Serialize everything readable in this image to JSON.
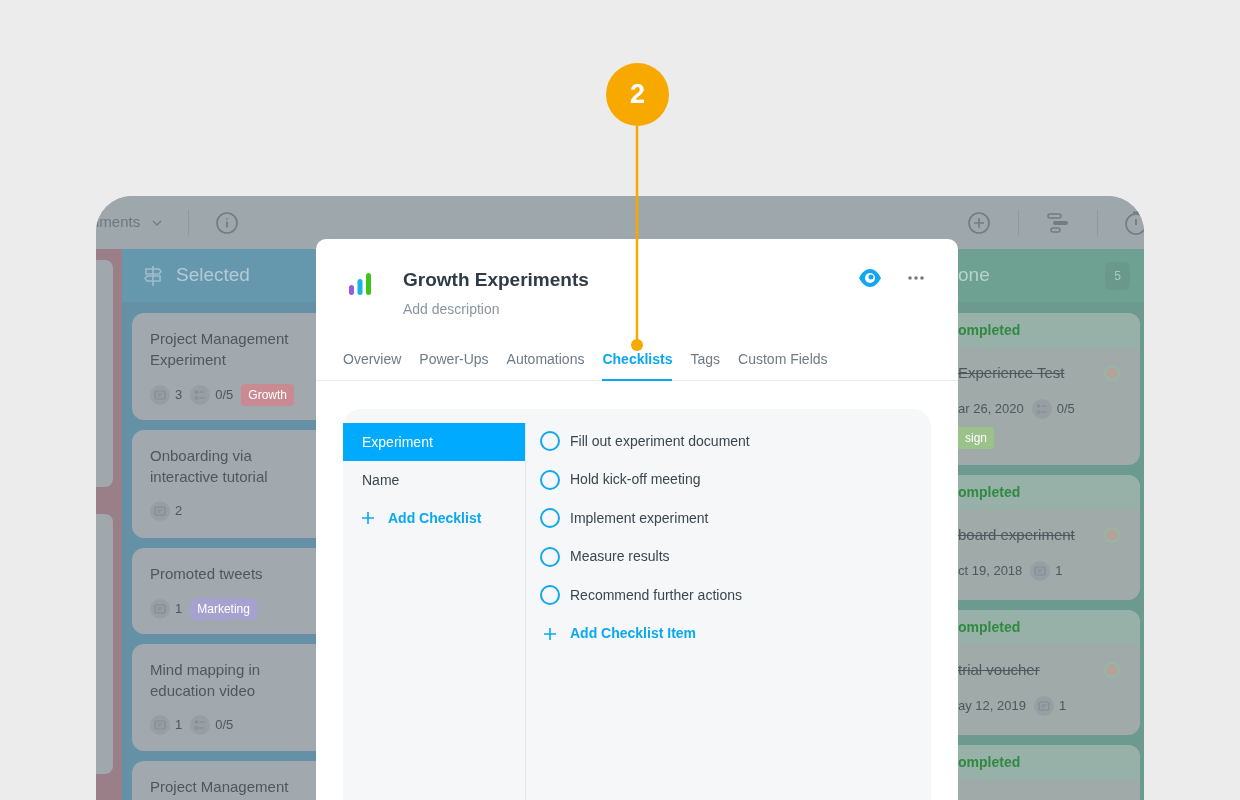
{
  "callout": {
    "number": "2"
  },
  "toolbar": {
    "view_name": "iments"
  },
  "selected_column": {
    "title": "Selected",
    "cards": [
      {
        "title": "Project Management Experiment",
        "comments": "3",
        "checklist": "0/5",
        "tag": {
          "label": "Growth",
          "color": "#c98a92"
        }
      },
      {
        "title": "Onboarding via interactive tutorial",
        "comments": "2"
      },
      {
        "title": "Promoted tweets",
        "comments": "1",
        "tag": {
          "label": "Marketing",
          "color": "#a7a1d0"
        }
      },
      {
        "title": "Mind mapping in education video",
        "comments": "1",
        "checklist": "0/5"
      },
      {
        "title": "Project Management"
      }
    ]
  },
  "done_column": {
    "title": "one",
    "count": "5",
    "cards": [
      {
        "status": "ompleted",
        "title": "Experience Test",
        "completed": true,
        "date": "ar 26, 2020",
        "checklist": "0/5",
        "tag": {
          "label": "sign",
          "color": "#9cc28c"
        }
      },
      {
        "status": "ompleted",
        "title": "board experiment",
        "completed": true,
        "date": "ct 19, 2018",
        "comments": "1"
      },
      {
        "status": "ompleted",
        "title": "trial voucher",
        "completed": true,
        "date": "ay 12, 2019",
        "comments": "1"
      },
      {
        "status": "ompleted"
      }
    ]
  },
  "modal": {
    "title": "Growth Experiments",
    "description": {
      "placeholder": "Add description"
    },
    "watching": true,
    "tabs": [
      {
        "label": "Overview",
        "selected": false
      },
      {
        "label": "Power-Ups",
        "selected": false
      },
      {
        "label": "Automations",
        "selected": false
      },
      {
        "label": "Checklists",
        "selected": true
      },
      {
        "label": "Tags",
        "selected": false
      },
      {
        "label": "Custom Fields",
        "selected": false
      }
    ],
    "checklists": [
      {
        "label": "Experiment",
        "selected": true
      },
      {
        "label": "Name",
        "selected": false
      }
    ],
    "add_checklist": "Add Checklist",
    "items": [
      {
        "label": "Fill out experiment document",
        "checked": false
      },
      {
        "label": "Hold kick-off meeting",
        "checked": false
      },
      {
        "label": "Implement experiment",
        "checked": false
      },
      {
        "label": "Measure results",
        "checked": false
      },
      {
        "label": "Recommend further actions",
        "checked": false
      }
    ],
    "add_item": "Add Checklist Item"
  }
}
